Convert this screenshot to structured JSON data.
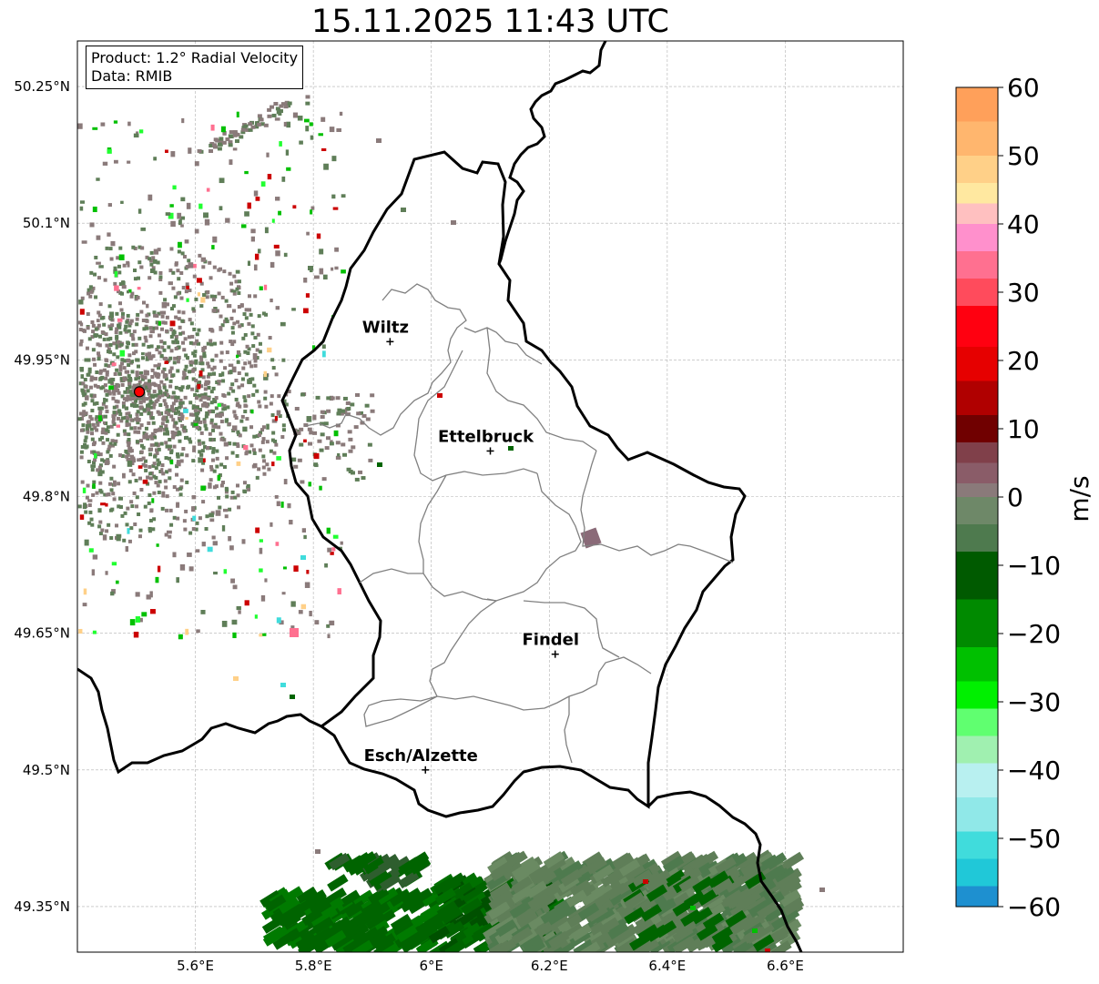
{
  "title": "15.11.2025 11:43 UTC",
  "info_box": {
    "product": "Product: 1.2° Radial Velocity",
    "data": "Data: RMIB"
  },
  "x_ticks": [
    {
      "value": 5.6,
      "label": "5.6°E"
    },
    {
      "value": 5.8,
      "label": "5.8°E"
    },
    {
      "value": 6.0,
      "label": "6°E"
    },
    {
      "value": 6.2,
      "label": "6.2°E"
    },
    {
      "value": 6.4,
      "label": "6.4°E"
    },
    {
      "value": 6.6,
      "label": "6.6°E"
    }
  ],
  "y_ticks": [
    {
      "value": 50.25,
      "label": "50.25°N"
    },
    {
      "value": 50.1,
      "label": "50.1°N"
    },
    {
      "value": 49.95,
      "label": "49.95°N"
    },
    {
      "value": 49.8,
      "label": "49.8°N"
    },
    {
      "value": 49.65,
      "label": "49.65°N"
    },
    {
      "value": 49.5,
      "label": "49.5°N"
    },
    {
      "value": 49.35,
      "label": "49.35°N"
    }
  ],
  "extent": {
    "lon": [
      5.4,
      6.8
    ],
    "lat": [
      49.3,
      50.3
    ]
  },
  "cities": [
    {
      "name": "Wiltz",
      "lon": 5.93,
      "lat": 49.97
    },
    {
      "name": "Ettelbruck",
      "lon": 6.1,
      "lat": 49.85
    },
    {
      "name": "Findel",
      "lon": 6.21,
      "lat": 49.627
    },
    {
      "name": "Esch/Alzette",
      "lon": 5.99,
      "lat": 49.5
    }
  ],
  "radar_site": {
    "lon": 5.505,
    "lat": 49.915,
    "color": "#ff0000"
  },
  "colorbar": {
    "label": "m/s",
    "min": -60,
    "max": 60,
    "ticks": [
      {
        "value": 60,
        "label": "60"
      },
      {
        "value": 50,
        "label": "50"
      },
      {
        "value": 40,
        "label": "40"
      },
      {
        "value": 30,
        "label": "30"
      },
      {
        "value": 20,
        "label": "20"
      },
      {
        "value": 10,
        "label": "10"
      },
      {
        "value": 0,
        "label": "0"
      },
      {
        "value": -10,
        "label": "−10"
      },
      {
        "value": -20,
        "label": "−20"
      },
      {
        "value": -30,
        "label": "−30"
      },
      {
        "value": -40,
        "label": "−40"
      },
      {
        "value": -50,
        "label": "−50"
      },
      {
        "value": -60,
        "label": "−60"
      }
    ],
    "stops": [
      {
        "value": 60,
        "color": "#ffa05a"
      },
      {
        "value": 55,
        "color": "#ffb66e"
      },
      {
        "value": 50,
        "color": "#ffd088"
      },
      {
        "value": 46,
        "color": "#ffe8a0"
      },
      {
        "value": 43,
        "color": "#ffc0c0"
      },
      {
        "value": 40,
        "color": "#ff90cc"
      },
      {
        "value": 36,
        "color": "#ff7090"
      },
      {
        "value": 32,
        "color": "#ff4b5c"
      },
      {
        "value": 28,
        "color": "#ff0010"
      },
      {
        "value": 22,
        "color": "#e60000"
      },
      {
        "value": 17,
        "color": "#b00000"
      },
      {
        "value": 12,
        "color": "#700000"
      },
      {
        "value": 8,
        "color": "#80404a"
      },
      {
        "value": 5,
        "color": "#8a5c68"
      },
      {
        "value": 2,
        "color": "#8a7a7a"
      },
      {
        "value": 0,
        "color": "#6e8868"
      },
      {
        "value": -4,
        "color": "#4e7a4e"
      },
      {
        "value": -8,
        "color": "#005a00"
      },
      {
        "value": -15,
        "color": "#008a00"
      },
      {
        "value": -22,
        "color": "#00c000"
      },
      {
        "value": -27,
        "color": "#00f000"
      },
      {
        "value": -31,
        "color": "#60ff70"
      },
      {
        "value": -35,
        "color": "#a0f0b0"
      },
      {
        "value": -39,
        "color": "#b8f0f0"
      },
      {
        "value": -44,
        "color": "#90e8e8"
      },
      {
        "value": -49,
        "color": "#40dcdc"
      },
      {
        "value": -53,
        "color": "#20c8d8"
      },
      {
        "value": -57,
        "color": "#1e90d0"
      }
    ]
  },
  "echo_colors": {
    "gray": "#8a7a7a",
    "olive": "#5f7e58",
    "dark_green": "#006400",
    "green": "#00c000",
    "bright_green": "#20ff30",
    "red": "#cc0000",
    "dark_red": "#800000",
    "cyan": "#40dcdc",
    "pink": "#ff7090",
    "peach": "#ffd088",
    "mauve": "#8a6a78"
  }
}
